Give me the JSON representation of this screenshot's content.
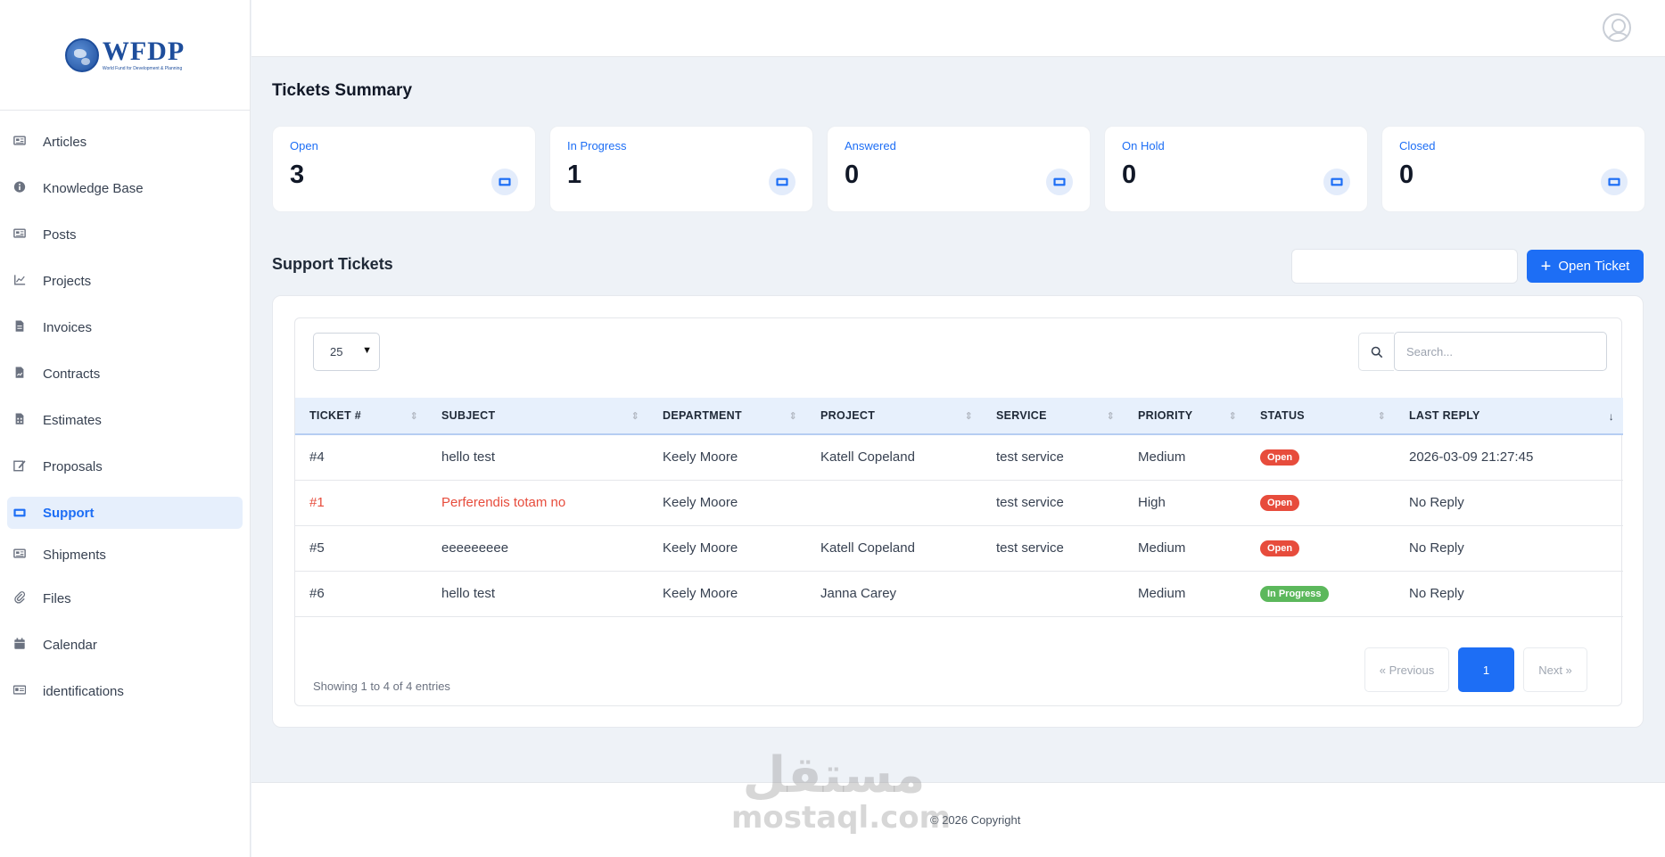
{
  "brand": {
    "name": "WFDP",
    "tagline": "World Fund for Development & Planning"
  },
  "sidebar": {
    "items": [
      {
        "label": "Articles",
        "icon": "newspaper-icon"
      },
      {
        "label": "Knowledge Base",
        "icon": "info-icon"
      },
      {
        "label": "Posts",
        "icon": "newspaper-icon"
      },
      {
        "label": "Projects",
        "icon": "chart-icon"
      },
      {
        "label": "Invoices",
        "icon": "invoice-icon"
      },
      {
        "label": "Contracts",
        "icon": "contract-icon"
      },
      {
        "label": "Estimates",
        "icon": "calculator-icon"
      },
      {
        "label": "Proposals",
        "icon": "proposal-icon"
      },
      {
        "label": "Support",
        "icon": "ticket-icon",
        "active": true
      },
      {
        "label": "Shipments",
        "icon": "shipment-icon"
      },
      {
        "label": "Files",
        "icon": "paperclip-icon"
      },
      {
        "label": "Calendar",
        "icon": "calendar-icon"
      },
      {
        "label": "identifications",
        "icon": "id-card-icon"
      }
    ]
  },
  "summary": {
    "title": "Tickets Summary",
    "cards": [
      {
        "label": "Open",
        "value": "3"
      },
      {
        "label": "In Progress",
        "value": "1"
      },
      {
        "label": "Answered",
        "value": "0"
      },
      {
        "label": "On Hold",
        "value": "0"
      },
      {
        "label": "Closed",
        "value": "0"
      }
    ]
  },
  "tickets": {
    "title": "Support Tickets",
    "open_button": "Open Ticket",
    "page_size": "25",
    "search_placeholder": "Search...",
    "columns": [
      "TICKET #",
      "SUBJECT",
      "DEPARTMENT",
      "PROJECT",
      "SERVICE",
      "PRIORITY",
      "STATUS",
      "LAST REPLY"
    ],
    "rows": [
      {
        "ticket": "#4",
        "subject": "hello test",
        "department": "Keely Moore",
        "project": "Katell Copeland",
        "service": "test service",
        "priority": "Medium",
        "status": "Open",
        "last_reply": "2026-03-09 21:27:45"
      },
      {
        "ticket": "#1",
        "subject": "Perferendis totam no",
        "department": "Keely Moore",
        "project": "",
        "service": "test service",
        "priority": "High",
        "status": "Open",
        "last_reply": "No Reply"
      },
      {
        "ticket": "#5",
        "subject": "eeeeeeeee",
        "department": "Keely Moore",
        "project": "Katell Copeland",
        "service": "test service",
        "priority": "Medium",
        "status": "Open",
        "last_reply": "No Reply"
      },
      {
        "ticket": "#6",
        "subject": "hello test",
        "department": "Keely Moore",
        "project": "Janna Carey",
        "service": "",
        "priority": "Medium",
        "status": "In Progress",
        "last_reply": "No Reply"
      }
    ],
    "showing": "Showing 1 to 4 of 4 entries",
    "pagination": {
      "prev": "« Previous",
      "current": "1",
      "next": "Next »"
    }
  },
  "footer": {
    "copyright": "© 2026 Copyright"
  },
  "watermark": {
    "arabic": "مستقل",
    "latin": "mostaql.com"
  },
  "colors": {
    "accent": "#1d6ef5",
    "danger": "#e74c3c",
    "success": "#5cb85c"
  }
}
